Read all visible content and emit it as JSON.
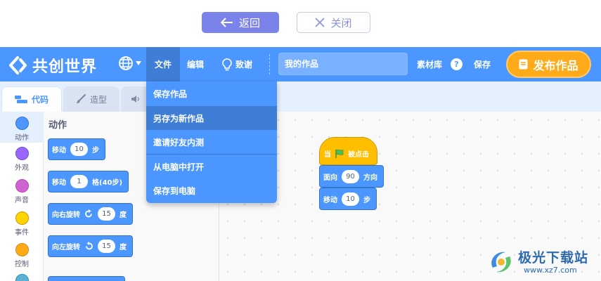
{
  "top_buttons": {
    "back_label": "返回",
    "close_label": "关闭"
  },
  "menubar": {
    "brand": "共创世界",
    "file": "文件",
    "edit": "编辑",
    "thanks": "致谢",
    "project_title": "我的作品",
    "assets": "素材库",
    "save": "保存",
    "publish": "发布作品"
  },
  "file_menu": {
    "items": [
      "保存作品",
      "另存为新作品",
      "邀请好友内测",
      "从电脑中打开",
      "保存到电脑"
    ],
    "highlighted": "另存为新作品"
  },
  "tabs": {
    "code": "代码",
    "costume": "造型"
  },
  "categories": [
    {
      "label": "动作",
      "color": "#4c97ff"
    },
    {
      "label": "外观",
      "color": "#9966ff"
    },
    {
      "label": "声音",
      "color": "#cf63cf"
    },
    {
      "label": "事件",
      "color": "#ffd500"
    },
    {
      "label": "控制",
      "color": "#ffab19"
    }
  ],
  "palette": {
    "title": "动作",
    "blocks": {
      "move": {
        "label": "移动",
        "value": "10",
        "suffix": "步"
      },
      "move_grid": {
        "label": "移动",
        "value": "1",
        "suffix": "格(40步)"
      },
      "turn_right": {
        "label": "向右旋转",
        "value": "15",
        "suffix": "度"
      },
      "turn_left": {
        "label": "向左旋转",
        "value": "15",
        "suffix": "度"
      }
    }
  },
  "workspace": {
    "hat": {
      "prefix": "当",
      "suffix": "被点击"
    },
    "point": {
      "label": "面向",
      "value": "90",
      "suffix": "方向"
    },
    "move": {
      "label": "移动",
      "value": "10",
      "suffix": "步"
    }
  },
  "watermark": {
    "name": "极光下载站",
    "url": "www.xz7.com"
  },
  "colors": {
    "menubar": "#4c97ff",
    "accent": "#7b82ea",
    "publish": "#ffab19",
    "event": "#ffbf00"
  }
}
